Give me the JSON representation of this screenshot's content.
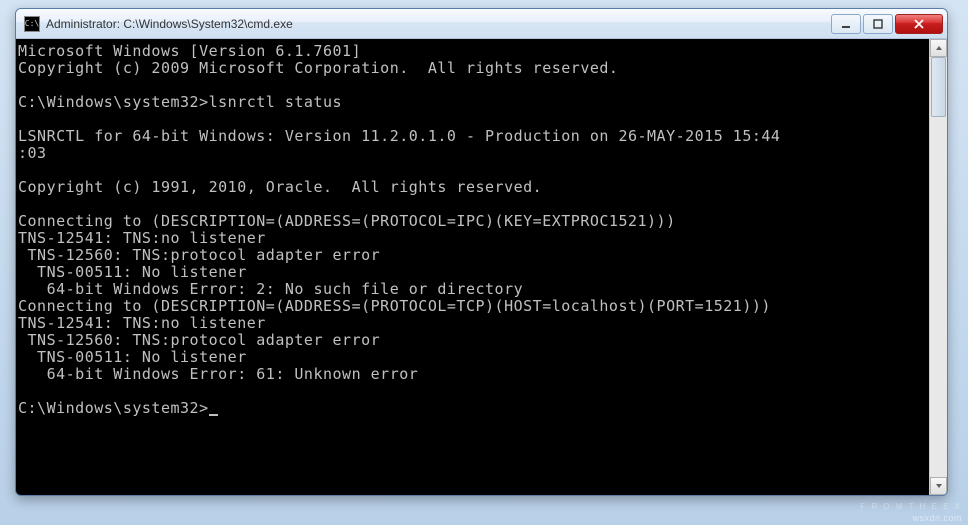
{
  "window": {
    "title": "Administrator: C:\\Windows\\System32\\cmd.exe",
    "icon_label": "C:\\"
  },
  "terminal": {
    "lines": [
      "Microsoft Windows [Version 6.1.7601]",
      "Copyright (c) 2009 Microsoft Corporation.  All rights reserved.",
      "",
      "C:\\Windows\\system32>lsnrctl status",
      "",
      "LSNRCTL for 64-bit Windows: Version 11.2.0.1.0 - Production on 26-MAY-2015 15:44",
      ":03",
      "",
      "Copyright (c) 1991, 2010, Oracle.  All rights reserved.",
      "",
      "Connecting to (DESCRIPTION=(ADDRESS=(PROTOCOL=IPC)(KEY=EXTPROC1521)))",
      "TNS-12541: TNS:no listener",
      " TNS-12560: TNS:protocol adapter error",
      "  TNS-00511: No listener",
      "   64-bit Windows Error: 2: No such file or directory",
      "Connecting to (DESCRIPTION=(ADDRESS=(PROTOCOL=TCP)(HOST=localhost)(PORT=1521)))",
      "TNS-12541: TNS:no listener",
      " TNS-12560: TNS:protocol adapter error",
      "  TNS-00511: No listener",
      "   64-bit Windows Error: 61: Unknown error",
      "",
      "C:\\Windows\\system32>"
    ],
    "prompt_has_cursor": true
  },
  "watermark": {
    "line1": "F R O M   T H E   E X",
    "line2": "wsxdn.com"
  }
}
